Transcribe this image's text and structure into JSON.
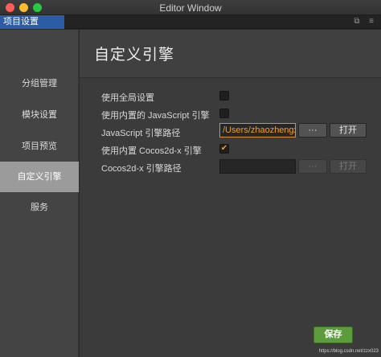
{
  "window": {
    "title": "Editor Window"
  },
  "tabbar": {
    "active_tab": "项目设置"
  },
  "sidebar": {
    "items": [
      {
        "label": "分组管理"
      },
      {
        "label": "模块设置"
      },
      {
        "label": "项目预览"
      },
      {
        "label": "自定义引擎"
      },
      {
        "label": "服务"
      }
    ],
    "active_index": 3
  },
  "main": {
    "title": "自定义引擎",
    "use_global": {
      "label": "使用全局设置",
      "checked": false
    },
    "use_builtin_js": {
      "label": "使用内置的 JavaScript 引擎",
      "checked": false
    },
    "js_path": {
      "label": "JavaScript 引擎路径",
      "value": "/Users/zhaozhengx",
      "browse_label": "···",
      "open_label": "打开"
    },
    "use_builtin_cocos": {
      "label": "使用内置 Cocos2d-x 引擎",
      "checked": true,
      "check_glyph": "✔"
    },
    "cocos_path": {
      "label": "Cocos2d-x 引擎路径",
      "value": "",
      "browse_label": "···",
      "open_label": "打开"
    },
    "save_label": "保存"
  },
  "watermark": "https://blog.csdn.net/zzx023",
  "colors": {
    "accent_tab": "#2c5ca6",
    "save_green": "#5d9c3c",
    "check_orange": "#f0a030"
  }
}
